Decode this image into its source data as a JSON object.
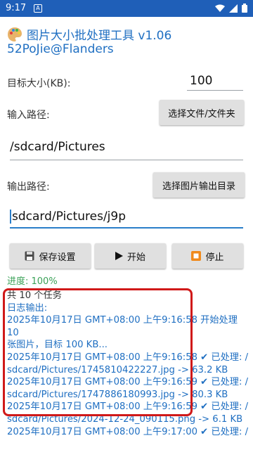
{
  "status_bar": {
    "time": "9:17",
    "notif_glyph": "A"
  },
  "header": {
    "title": "图片大小批处理工具 v1.06",
    "subtitle": "52PoJie@Flanders",
    "icon": "palette-icon"
  },
  "target_size": {
    "label": "目标大小(KB):",
    "value": "100"
  },
  "input": {
    "label": "输入路径:",
    "button": "选择文件/文件夹",
    "path": "/sdcard/Pictures"
  },
  "output": {
    "label": "输出路径:",
    "button": "选择图片输出目录",
    "path": "sdcard/Pictures/j9p"
  },
  "actions": {
    "save": "保存设置",
    "start": "开始",
    "stop": "停止"
  },
  "progress": {
    "label": "进度: 100%",
    "value": 1.0
  },
  "log": {
    "tasks": "共 10 个任务",
    "header": "日志输出:",
    "lines": [
      "2025年10月17日 GMT+08:00 上午9:16:58 开始处理 10",
      "张图片，目标 100 KB...",
      "2025年10月17日 GMT+08:00 上午9:16:58 ✔ 已处理: /",
      "sdcard/Pictures/1745810422227.jpg -> 63.2 KB",
      "2025年10月17日 GMT+08:00 上午9:16:59 ✔ 已处理: /",
      "sdcard/Pictures/1747886180993.jpg -> 80.3 KB",
      "2025年10月17日 GMT+08:00 上午9:16:59 ✔ 已处理: /",
      "sdcard/Pictures/2024-12-24_090115.png -> 6.1 KB",
      "2025年10月17日 GMT+08:00 上午9:17:00 ✔ 已处理: /"
    ]
  },
  "colors": {
    "accent": "#1f6fc2",
    "status_bar": "#1f5fb8",
    "progress": "#3aa157",
    "highlight": "#d01919"
  }
}
